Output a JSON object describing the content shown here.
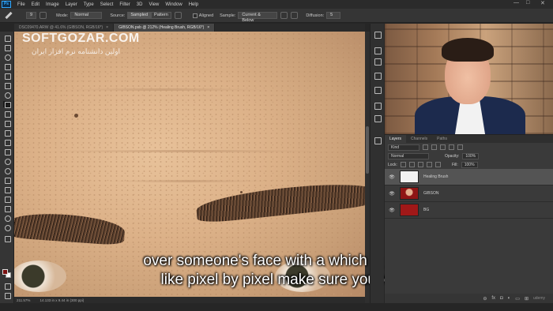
{
  "menu": [
    "File",
    "Edit",
    "Image",
    "Layer",
    "Type",
    "Select",
    "Filter",
    "3D",
    "View",
    "Window",
    "Help"
  ],
  "app_icon": "Ps",
  "window_controls": [
    "—",
    "□",
    "✕"
  ],
  "options": {
    "brush_size": "9",
    "mode_label": "Mode:",
    "mode_value": "Normal",
    "source_label": "Source:",
    "source_sampled": "Sampled",
    "source_pattern": "Pattern",
    "aligned_label": "Aligned",
    "sample_label": "Sample:",
    "sample_value": "Current & Below",
    "diffusion_label": "Diffusion:",
    "diffusion_value": "5"
  },
  "tabs": [
    {
      "label": "DSC09470.ARW @ 41.6% (GIBSON, RGB/16*)",
      "close": "×"
    },
    {
      "label": "GIBSON.psb @ 212% (Healing Brush, RGB/16*)",
      "close": "×"
    }
  ],
  "watermark": {
    "title": "SOFTGOZAR.COM",
    "subtitle": "اولین دانشنامه نرم افزار ایران"
  },
  "canvas_status": {
    "zoom": "211.57%",
    "doc_size": "14.133 in x 9.44 in (300 ppi)"
  },
  "subtitles": {
    "line1": "over someone's face with a which is just",
    "line2": "like pixel by pixel make sure you're"
  },
  "layers_panel": {
    "tabs": [
      "Layers",
      "Channels",
      "Paths"
    ],
    "filter_kind": "Kind",
    "blend_mode": "Normal",
    "opacity_label": "Opacity:",
    "opacity_value": "100%",
    "lock_label": "Lock:",
    "fill_label": "Fill:",
    "fill_value": "100%",
    "layers": [
      {
        "name": "Healing Brush",
        "selected": true,
        "thumb_color": "#f2f2f2"
      },
      {
        "name": "GIBSON",
        "selected": false,
        "thumb_color": "#8f1515"
      },
      {
        "name": "BG",
        "selected": false,
        "thumb_color": "#a01818"
      }
    ],
    "footer_icons": [
      "link-icon",
      "fx-icon",
      "mask-icon",
      "adjustment-icon",
      "folder-icon",
      "new-layer-icon",
      "trash-icon"
    ],
    "footer_glyphs": [
      "⊖",
      "fx",
      "◘",
      "◐",
      "▭",
      "⊞",
      "🗑"
    ]
  },
  "brand": "udemy"
}
